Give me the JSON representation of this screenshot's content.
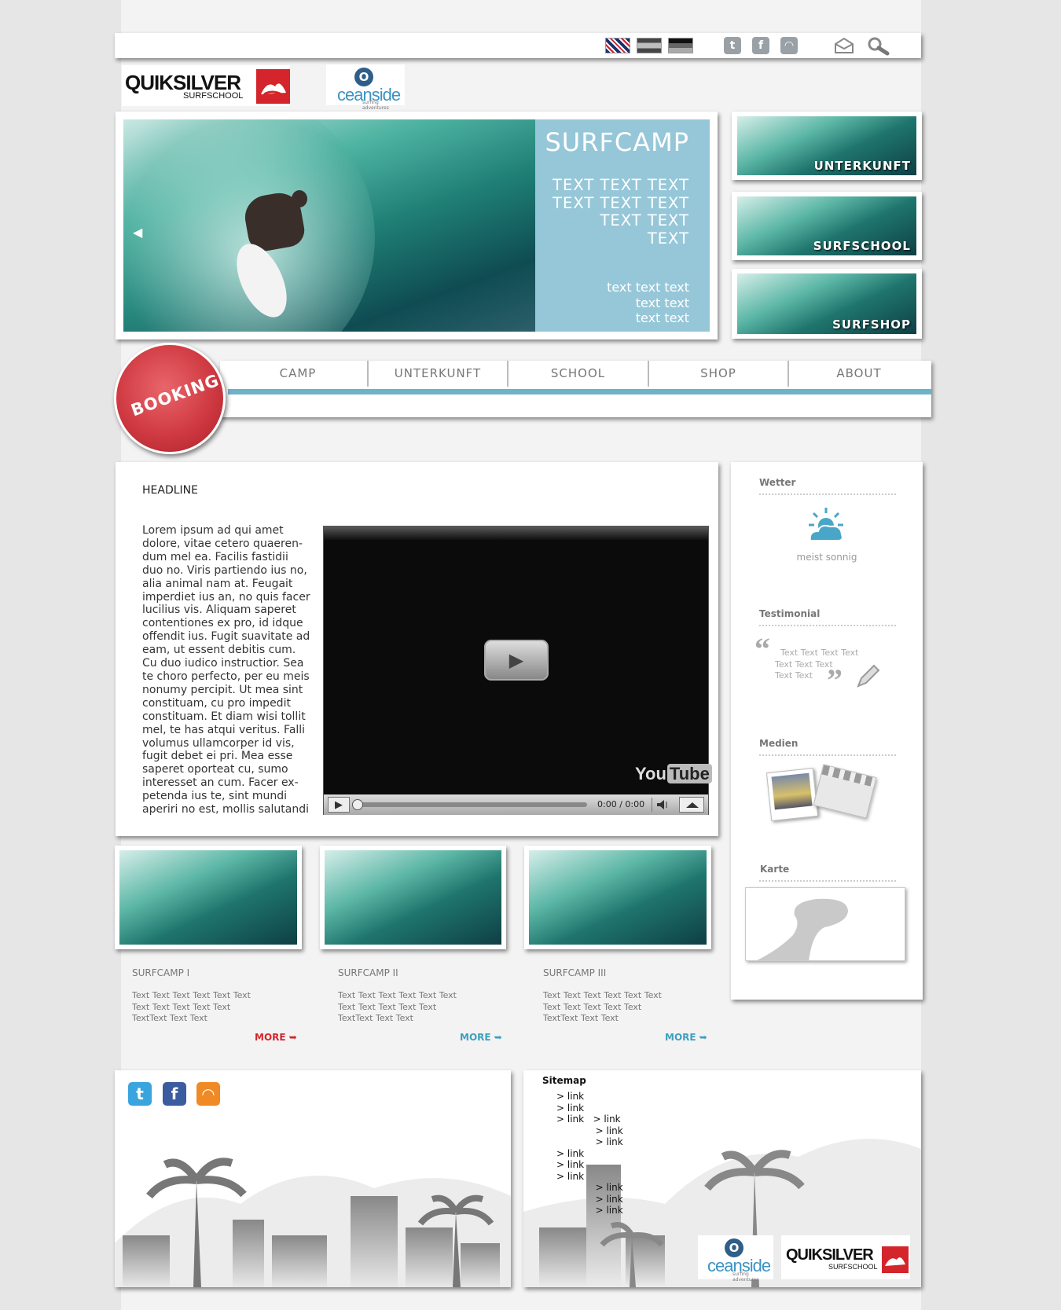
{
  "topbar": {
    "languages": [
      {
        "name": "english-flag-icon"
      },
      {
        "name": "spanish-flag-icon"
      },
      {
        "name": "german-flag-icon"
      }
    ],
    "social": [
      {
        "name": "twitter-icon",
        "glyph": "t"
      },
      {
        "name": "facebook-icon",
        "glyph": "f"
      },
      {
        "name": "rss-icon",
        "glyph": "◠"
      }
    ],
    "tools": [
      "mail-icon",
      "search-icon"
    ]
  },
  "brand": {
    "quiksilver": "QUIKSILVER",
    "quiksilver_sub": "SURFSCHOOL",
    "oceanside_o": "O",
    "oceanside": "ceanside",
    "oceanside_tag": "surfing adventures",
    "red": "#d3252b",
    "blue": "#3d93c4"
  },
  "hero": {
    "title": "SURFCAMP",
    "lines": [
      "TEXT TEXT TEXT",
      "TEXT TEXT TEXT",
      "TEXT TEXT",
      "TEXT"
    ],
    "small_lines": [
      "text text text",
      "text text",
      "text text"
    ],
    "prev_arrow": "◀",
    "panel_color": "#96c7d8"
  },
  "side_thumbs": [
    "UNTERKUNFT",
    "SURFSCHOOL",
    "SURFSHOP"
  ],
  "nav": {
    "items": [
      "CAMP",
      "UNTERKUNFT",
      "SCHOOL",
      "SHOP",
      "ABOUT"
    ],
    "booking": "BOOKING",
    "accent": "#6fb1c7"
  },
  "article": {
    "headline": "HEADLINE",
    "lines": [
      "Lorem ipsum ad qui amet",
      "dolore, vitae cetero quaeren-",
      "dum mel ea. Facilis fastidii",
      "duo no. Viris partiendo ius no,",
      "alia animal nam at. Feugait",
      "imperdiet ius an, no quis facer",
      "lucilius vis. Aliquam saperet",
      "contentiones ex pro, id idque",
      "offendit ius. Fugit suavitate ad",
      "eam, ut essent debitis cum.",
      "Cu duo iudico instructior. Sea",
      "te choro perfecto, per eu meis",
      "nonumy percipit. Ut mea sint",
      "constituam, cu pro impedit",
      "constituam. Et diam wisi tollit",
      "mel, te has atqui veritus. Falli",
      "volumus ullamcorper id vis,",
      "fugit debet ei pri. Mea esse",
      "saperet oporteat cu, sumo",
      "interesset an cum. Facer ex-",
      "petenda ius te, sint mundi",
      "aperiri no est, mollis salutandi"
    ]
  },
  "video": {
    "brand_you": "You",
    "brand_tube": "Tube",
    "time": "0:00 / 0:00",
    "play_glyph": "▶"
  },
  "camps": [
    {
      "title": "SURFCAMP I",
      "lines": [
        "Text Text Text Text Text Text",
        "Text Text Text Text Text",
        "TextText Text Text"
      ],
      "more": "MORE",
      "color": "#d3252b"
    },
    {
      "title": "SURFCAMP II",
      "lines": [
        "Text Text Text Text Text Text",
        "Text Text Text Text Text",
        "TextText Text Text"
      ],
      "more": "MORE",
      "color": "#3d9fc0"
    },
    {
      "title": "SURFCAMP III",
      "lines": [
        "Text Text Text Text Text Text",
        "Text Text Text Text Text",
        "TextText Text Text"
      ],
      "more": "MORE",
      "color": "#3d9fc0"
    }
  ],
  "sidebar": {
    "weather_title": "Wetter",
    "weather_text": "meist sonnig",
    "testimonial_title": "Testimonial",
    "testimonial_lines": [
      "Text Text Text Text",
      "Text Text Text",
      "Text Text"
    ],
    "quote_open": "“",
    "quote_close": "”",
    "media_title": "Medien",
    "map_title": "Karte"
  },
  "footer": {
    "social": [
      {
        "name": "twitter-icon",
        "glyph": "t",
        "color": "#3aa4de"
      },
      {
        "name": "facebook-icon",
        "glyph": "f",
        "color": "#3b5c9e"
      },
      {
        "name": "rss-icon",
        "glyph": "◠",
        "color": "#f08a24"
      }
    ],
    "sitemap_title": "Sitemap",
    "links": [
      "> link",
      "> link",
      "> link   > link",
      "             > link",
      "             > link",
      "> link",
      "> link",
      "> link",
      "             > link",
      "             > link",
      "             > link"
    ]
  }
}
